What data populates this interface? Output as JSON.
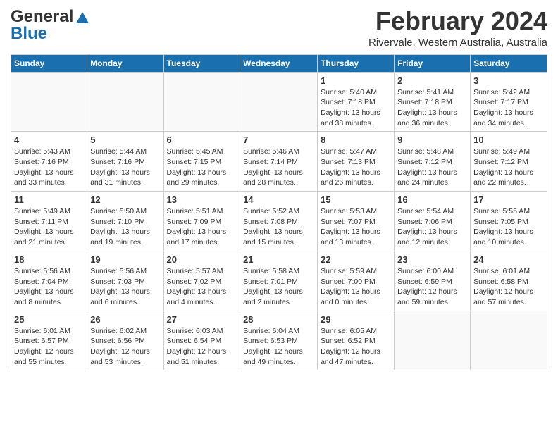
{
  "logo": {
    "line1": "General",
    "line2": "Blue"
  },
  "title": "February 2024",
  "subtitle": "Rivervale, Western Australia, Australia",
  "days_of_week": [
    "Sunday",
    "Monday",
    "Tuesday",
    "Wednesday",
    "Thursday",
    "Friday",
    "Saturday"
  ],
  "weeks": [
    [
      {
        "day": "",
        "info": ""
      },
      {
        "day": "",
        "info": ""
      },
      {
        "day": "",
        "info": ""
      },
      {
        "day": "",
        "info": ""
      },
      {
        "day": "1",
        "info": "Sunrise: 5:40 AM\nSunset: 7:18 PM\nDaylight: 13 hours\nand 38 minutes."
      },
      {
        "day": "2",
        "info": "Sunrise: 5:41 AM\nSunset: 7:18 PM\nDaylight: 13 hours\nand 36 minutes."
      },
      {
        "day": "3",
        "info": "Sunrise: 5:42 AM\nSunset: 7:17 PM\nDaylight: 13 hours\nand 34 minutes."
      }
    ],
    [
      {
        "day": "4",
        "info": "Sunrise: 5:43 AM\nSunset: 7:16 PM\nDaylight: 13 hours\nand 33 minutes."
      },
      {
        "day": "5",
        "info": "Sunrise: 5:44 AM\nSunset: 7:16 PM\nDaylight: 13 hours\nand 31 minutes."
      },
      {
        "day": "6",
        "info": "Sunrise: 5:45 AM\nSunset: 7:15 PM\nDaylight: 13 hours\nand 29 minutes."
      },
      {
        "day": "7",
        "info": "Sunrise: 5:46 AM\nSunset: 7:14 PM\nDaylight: 13 hours\nand 28 minutes."
      },
      {
        "day": "8",
        "info": "Sunrise: 5:47 AM\nSunset: 7:13 PM\nDaylight: 13 hours\nand 26 minutes."
      },
      {
        "day": "9",
        "info": "Sunrise: 5:48 AM\nSunset: 7:12 PM\nDaylight: 13 hours\nand 24 minutes."
      },
      {
        "day": "10",
        "info": "Sunrise: 5:49 AM\nSunset: 7:12 PM\nDaylight: 13 hours\nand 22 minutes."
      }
    ],
    [
      {
        "day": "11",
        "info": "Sunrise: 5:49 AM\nSunset: 7:11 PM\nDaylight: 13 hours\nand 21 minutes."
      },
      {
        "day": "12",
        "info": "Sunrise: 5:50 AM\nSunset: 7:10 PM\nDaylight: 13 hours\nand 19 minutes."
      },
      {
        "day": "13",
        "info": "Sunrise: 5:51 AM\nSunset: 7:09 PM\nDaylight: 13 hours\nand 17 minutes."
      },
      {
        "day": "14",
        "info": "Sunrise: 5:52 AM\nSunset: 7:08 PM\nDaylight: 13 hours\nand 15 minutes."
      },
      {
        "day": "15",
        "info": "Sunrise: 5:53 AM\nSunset: 7:07 PM\nDaylight: 13 hours\nand 13 minutes."
      },
      {
        "day": "16",
        "info": "Sunrise: 5:54 AM\nSunset: 7:06 PM\nDaylight: 13 hours\nand 12 minutes."
      },
      {
        "day": "17",
        "info": "Sunrise: 5:55 AM\nSunset: 7:05 PM\nDaylight: 13 hours\nand 10 minutes."
      }
    ],
    [
      {
        "day": "18",
        "info": "Sunrise: 5:56 AM\nSunset: 7:04 PM\nDaylight: 13 hours\nand 8 minutes."
      },
      {
        "day": "19",
        "info": "Sunrise: 5:56 AM\nSunset: 7:03 PM\nDaylight: 13 hours\nand 6 minutes."
      },
      {
        "day": "20",
        "info": "Sunrise: 5:57 AM\nSunset: 7:02 PM\nDaylight: 13 hours\nand 4 minutes."
      },
      {
        "day": "21",
        "info": "Sunrise: 5:58 AM\nSunset: 7:01 PM\nDaylight: 13 hours\nand 2 minutes."
      },
      {
        "day": "22",
        "info": "Sunrise: 5:59 AM\nSunset: 7:00 PM\nDaylight: 13 hours\nand 0 minutes."
      },
      {
        "day": "23",
        "info": "Sunrise: 6:00 AM\nSunset: 6:59 PM\nDaylight: 12 hours\nand 59 minutes."
      },
      {
        "day": "24",
        "info": "Sunrise: 6:01 AM\nSunset: 6:58 PM\nDaylight: 12 hours\nand 57 minutes."
      }
    ],
    [
      {
        "day": "25",
        "info": "Sunrise: 6:01 AM\nSunset: 6:57 PM\nDaylight: 12 hours\nand 55 minutes."
      },
      {
        "day": "26",
        "info": "Sunrise: 6:02 AM\nSunset: 6:56 PM\nDaylight: 12 hours\nand 53 minutes."
      },
      {
        "day": "27",
        "info": "Sunrise: 6:03 AM\nSunset: 6:54 PM\nDaylight: 12 hours\nand 51 minutes."
      },
      {
        "day": "28",
        "info": "Sunrise: 6:04 AM\nSunset: 6:53 PM\nDaylight: 12 hours\nand 49 minutes."
      },
      {
        "day": "29",
        "info": "Sunrise: 6:05 AM\nSunset: 6:52 PM\nDaylight: 12 hours\nand 47 minutes."
      },
      {
        "day": "",
        "info": ""
      },
      {
        "day": "",
        "info": ""
      }
    ]
  ]
}
